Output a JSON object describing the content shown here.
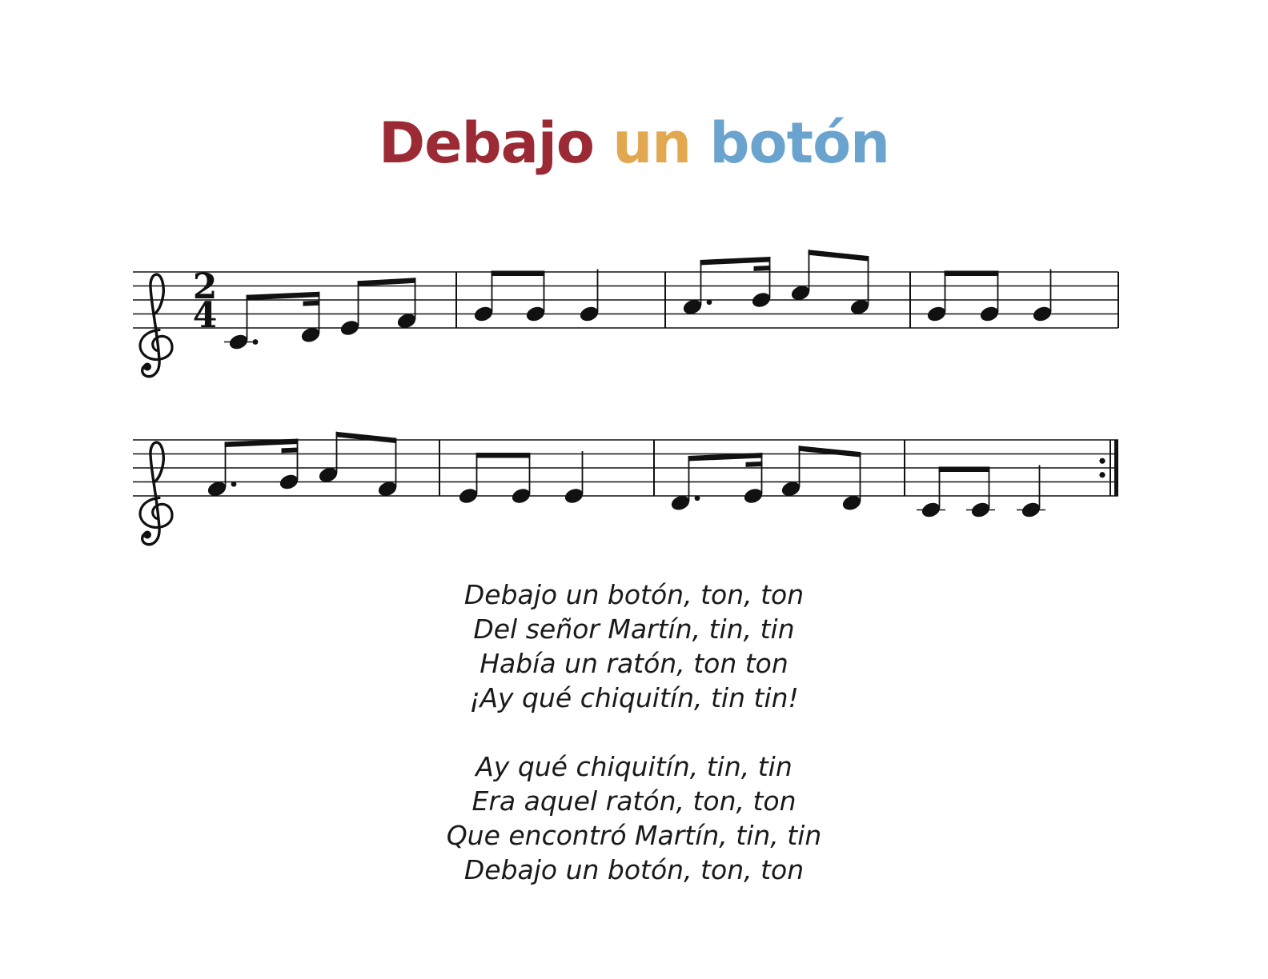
{
  "title": {
    "words": [
      {
        "text": "Debajo",
        "color": "#9b2a35"
      },
      {
        "text": "un",
        "color": "#e1a84f"
      },
      {
        "text": "botón",
        "color": "#6ba3cf"
      }
    ]
  },
  "score": {
    "clef": "treble",
    "time_signature": {
      "top": "2",
      "bottom": "4"
    },
    "ending": "repeat",
    "systems": [
      {
        "measures": [
          [
            {
              "p": "C4",
              "d": "8.",
              "g": 1
            },
            {
              "p": "D4",
              "d": "16",
              "g": 1
            },
            {
              "p": "E4",
              "d": "8",
              "g": 2
            },
            {
              "p": "F4",
              "d": "8",
              "g": 2
            }
          ],
          [
            {
              "p": "G4",
              "d": "8",
              "g": 1
            },
            {
              "p": "G4",
              "d": "8",
              "g": 1
            },
            {
              "p": "G4",
              "d": "4"
            }
          ],
          [
            {
              "p": "A4",
              "d": "8.",
              "g": 1
            },
            {
              "p": "B4",
              "d": "16",
              "g": 1
            },
            {
              "p": "C5",
              "d": "8",
              "g": 2
            },
            {
              "p": "A4",
              "d": "8",
              "g": 2
            }
          ],
          [
            {
              "p": "G4",
              "d": "8",
              "g": 1
            },
            {
              "p": "G4",
              "d": "8",
              "g": 1
            },
            {
              "p": "G4",
              "d": "4"
            }
          ]
        ]
      },
      {
        "measures": [
          [
            {
              "p": "F4",
              "d": "8.",
              "g": 1
            },
            {
              "p": "G4",
              "d": "16",
              "g": 1
            },
            {
              "p": "A4",
              "d": "8",
              "g": 2
            },
            {
              "p": "F4",
              "d": "8",
              "g": 2
            }
          ],
          [
            {
              "p": "E4",
              "d": "8",
              "g": 1
            },
            {
              "p": "E4",
              "d": "8",
              "g": 1
            },
            {
              "p": "E4",
              "d": "4"
            }
          ],
          [
            {
              "p": "D4",
              "d": "8.",
              "g": 1
            },
            {
              "p": "E4",
              "d": "16",
              "g": 1
            },
            {
              "p": "F4",
              "d": "8",
              "g": 2
            },
            {
              "p": "D4",
              "d": "8",
              "g": 2
            }
          ],
          [
            {
              "p": "C4",
              "d": "8",
              "g": 1
            },
            {
              "p": "C4",
              "d": "8",
              "g": 1
            },
            {
              "p": "C4",
              "d": "4"
            }
          ]
        ]
      }
    ]
  },
  "lyrics": {
    "stanzas": [
      [
        "Debajo un botón, ton, ton",
        "Del señor Martín, tin, tin",
        "Había un ratón, ton ton",
        "¡Ay qué chiquitín, tin tin!"
      ],
      [
        "Ay qué chiquitín, tin, tin",
        "Era aquel ratón, ton, ton",
        "Que encontró Martín, tin, tin",
        "Debajo un botón, ton, ton"
      ]
    ]
  }
}
